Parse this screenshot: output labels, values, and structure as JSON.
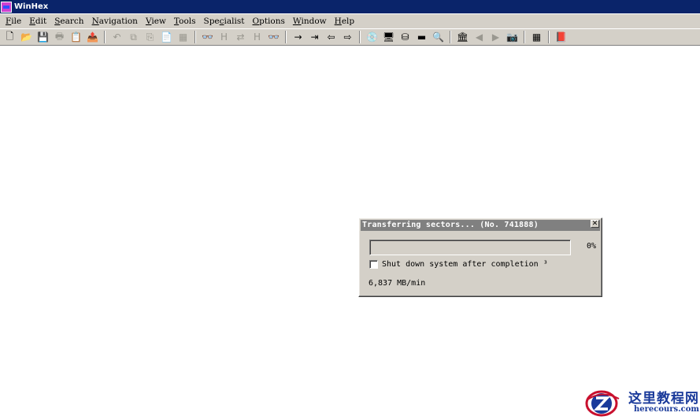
{
  "window": {
    "title": "WinHex"
  },
  "menu": {
    "items": [
      {
        "pre": "",
        "ul": "F",
        "post": "ile"
      },
      {
        "pre": "",
        "ul": "E",
        "post": "dit"
      },
      {
        "pre": "",
        "ul": "S",
        "post": "earch"
      },
      {
        "pre": "",
        "ul": "N",
        "post": "avigation"
      },
      {
        "pre": "",
        "ul": "V",
        "post": "iew"
      },
      {
        "pre": "",
        "ul": "T",
        "post": "ools"
      },
      {
        "pre": "Spe",
        "ul": "c",
        "post": "ialist"
      },
      {
        "pre": "",
        "ul": "O",
        "post": "ptions"
      },
      {
        "pre": "",
        "ul": "W",
        "post": "indow"
      },
      {
        "pre": "",
        "ul": "H",
        "post": "elp"
      }
    ]
  },
  "toolbar": {
    "new": "🗋",
    "open": "📂",
    "save": "💾",
    "print": "🖶",
    "properties": "📋",
    "export": "📤",
    "undo": "↶",
    "copy": "⧉",
    "cut": "⎘",
    "paste": "📄",
    "paste_special": "▦",
    "find_text": "👓",
    "find_hex": "H",
    "replace_text": "⇄",
    "replace_hex": "H",
    "find_next": "👓",
    "goto_offset": "→",
    "goto_sector": "⇥",
    "back": "⇦",
    "forward": "⇨",
    "open_disk": "💿",
    "ram_editor": "🖥",
    "copy_sectors": "⛁",
    "calculator": "▬",
    "search_disk": "🔍",
    "analyze": "🏛",
    "prev": "◀",
    "next": "▶",
    "snapshot": "📷",
    "table": "▦",
    "help": "📕"
  },
  "dialog": {
    "title": "Transferring sectors... (No. 741888)",
    "close": "✕",
    "progress": 0,
    "percent_label": "0%",
    "checkbox_label": "Shut down system after completion",
    "checkbox_suffix": "³",
    "rate": "6,837 MB/min"
  },
  "watermark": {
    "cn": "这里教程网",
    "url": "herecours.com"
  },
  "colors": {
    "title_active": "#0a246a",
    "dialog_title_inactive": "#808080",
    "chrome": "#d4d0c8",
    "watermark": "#1a3a9a"
  }
}
